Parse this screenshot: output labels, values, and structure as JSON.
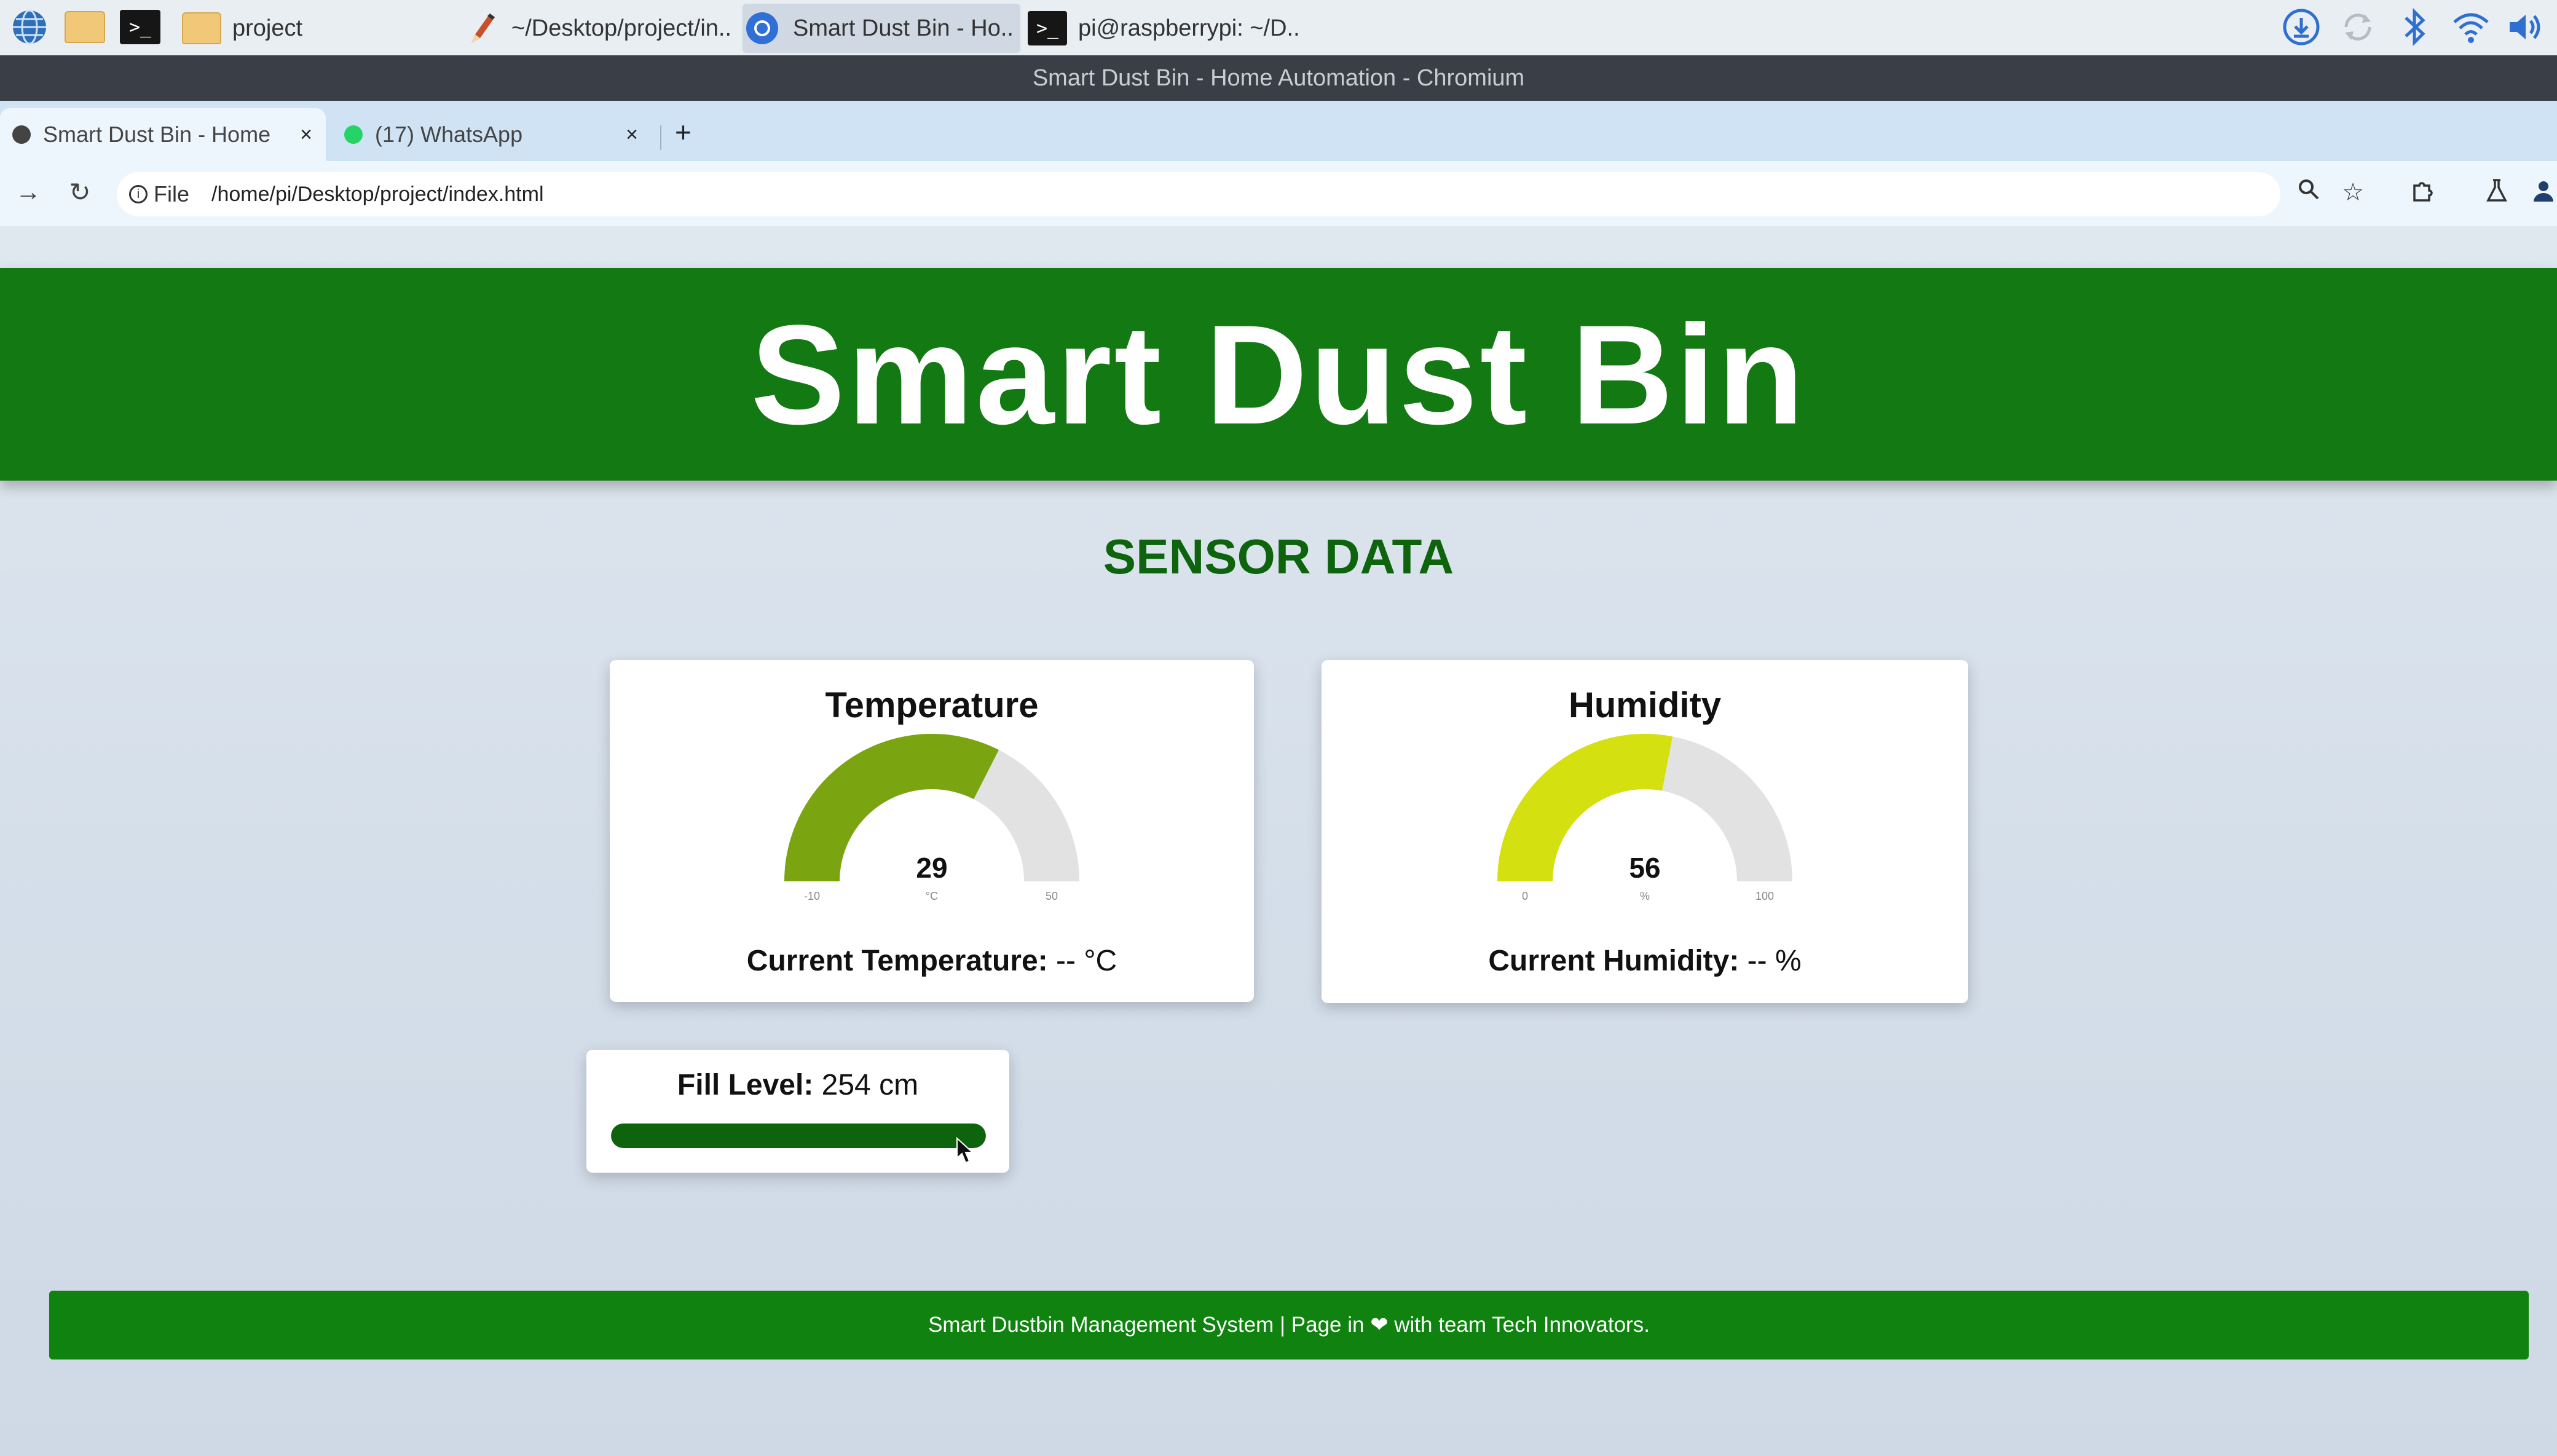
{
  "taskbar": {
    "apps": [
      {
        "icon": "globe-icon"
      },
      {
        "icon": "file-manager-icon"
      },
      {
        "icon": "terminal-icon",
        "glyph": ">_"
      }
    ],
    "windows": [
      {
        "label": "project",
        "icon": "folder-icon"
      },
      {
        "label": "~/Desktop/project/in..",
        "icon": "text-editor-icon"
      },
      {
        "label": "Smart Dust Bin - Ho..",
        "icon": "chromium-icon"
      },
      {
        "label": "pi@raspberrypi: ~/D..",
        "icon": "terminal-icon",
        "glyph": ">_"
      }
    ],
    "tray": [
      "download-icon",
      "sync-icon",
      "bluetooth-icon",
      "wifi-icon",
      "volume-icon"
    ]
  },
  "window_title": "Smart Dust Bin - Home Automation - Chromium",
  "tabs": [
    {
      "label": "Smart Dust Bin - Home",
      "close": "×",
      "favicon_color": "#444444"
    },
    {
      "label": "(17) WhatsApp",
      "close": "×",
      "favicon_color": "#25d366"
    }
  ],
  "new_tab": "+",
  "address_bar": {
    "scheme_label": "File",
    "url": "/home/pi/Desktop/project/index.html"
  },
  "page": {
    "header": "Smart Dust Bin",
    "section_title": "SENSOR DATA",
    "temperature": {
      "title": "Temperature",
      "gauge_value": "29",
      "value": 29,
      "unit": "°C",
      "min": -10,
      "min_label": "-10",
      "max": 50,
      "max_label": "50",
      "color": "#7aa511",
      "reading_label": "Current Temperature:",
      "reading_value": "-- °C"
    },
    "humidity": {
      "title": "Humidity",
      "gauge_value": "56",
      "value": 56,
      "unit": "%",
      "min": 0,
      "min_label": "0",
      "max": 100,
      "max_label": "100",
      "color": "#d4e010",
      "reading_label": "Current Humidity:",
      "reading_value": "-- %"
    },
    "fill_level": {
      "label": "Fill Level:",
      "value_text": "254 cm",
      "bar_fraction": 1.0,
      "color": "#0d640d"
    },
    "footer": "Smart Dustbin Management System | Page in ❤ with team Tech Innovators."
  },
  "colors": {
    "header_green": "#137a13",
    "footer_green": "#0f820f",
    "section_green": "#0d640d"
  }
}
